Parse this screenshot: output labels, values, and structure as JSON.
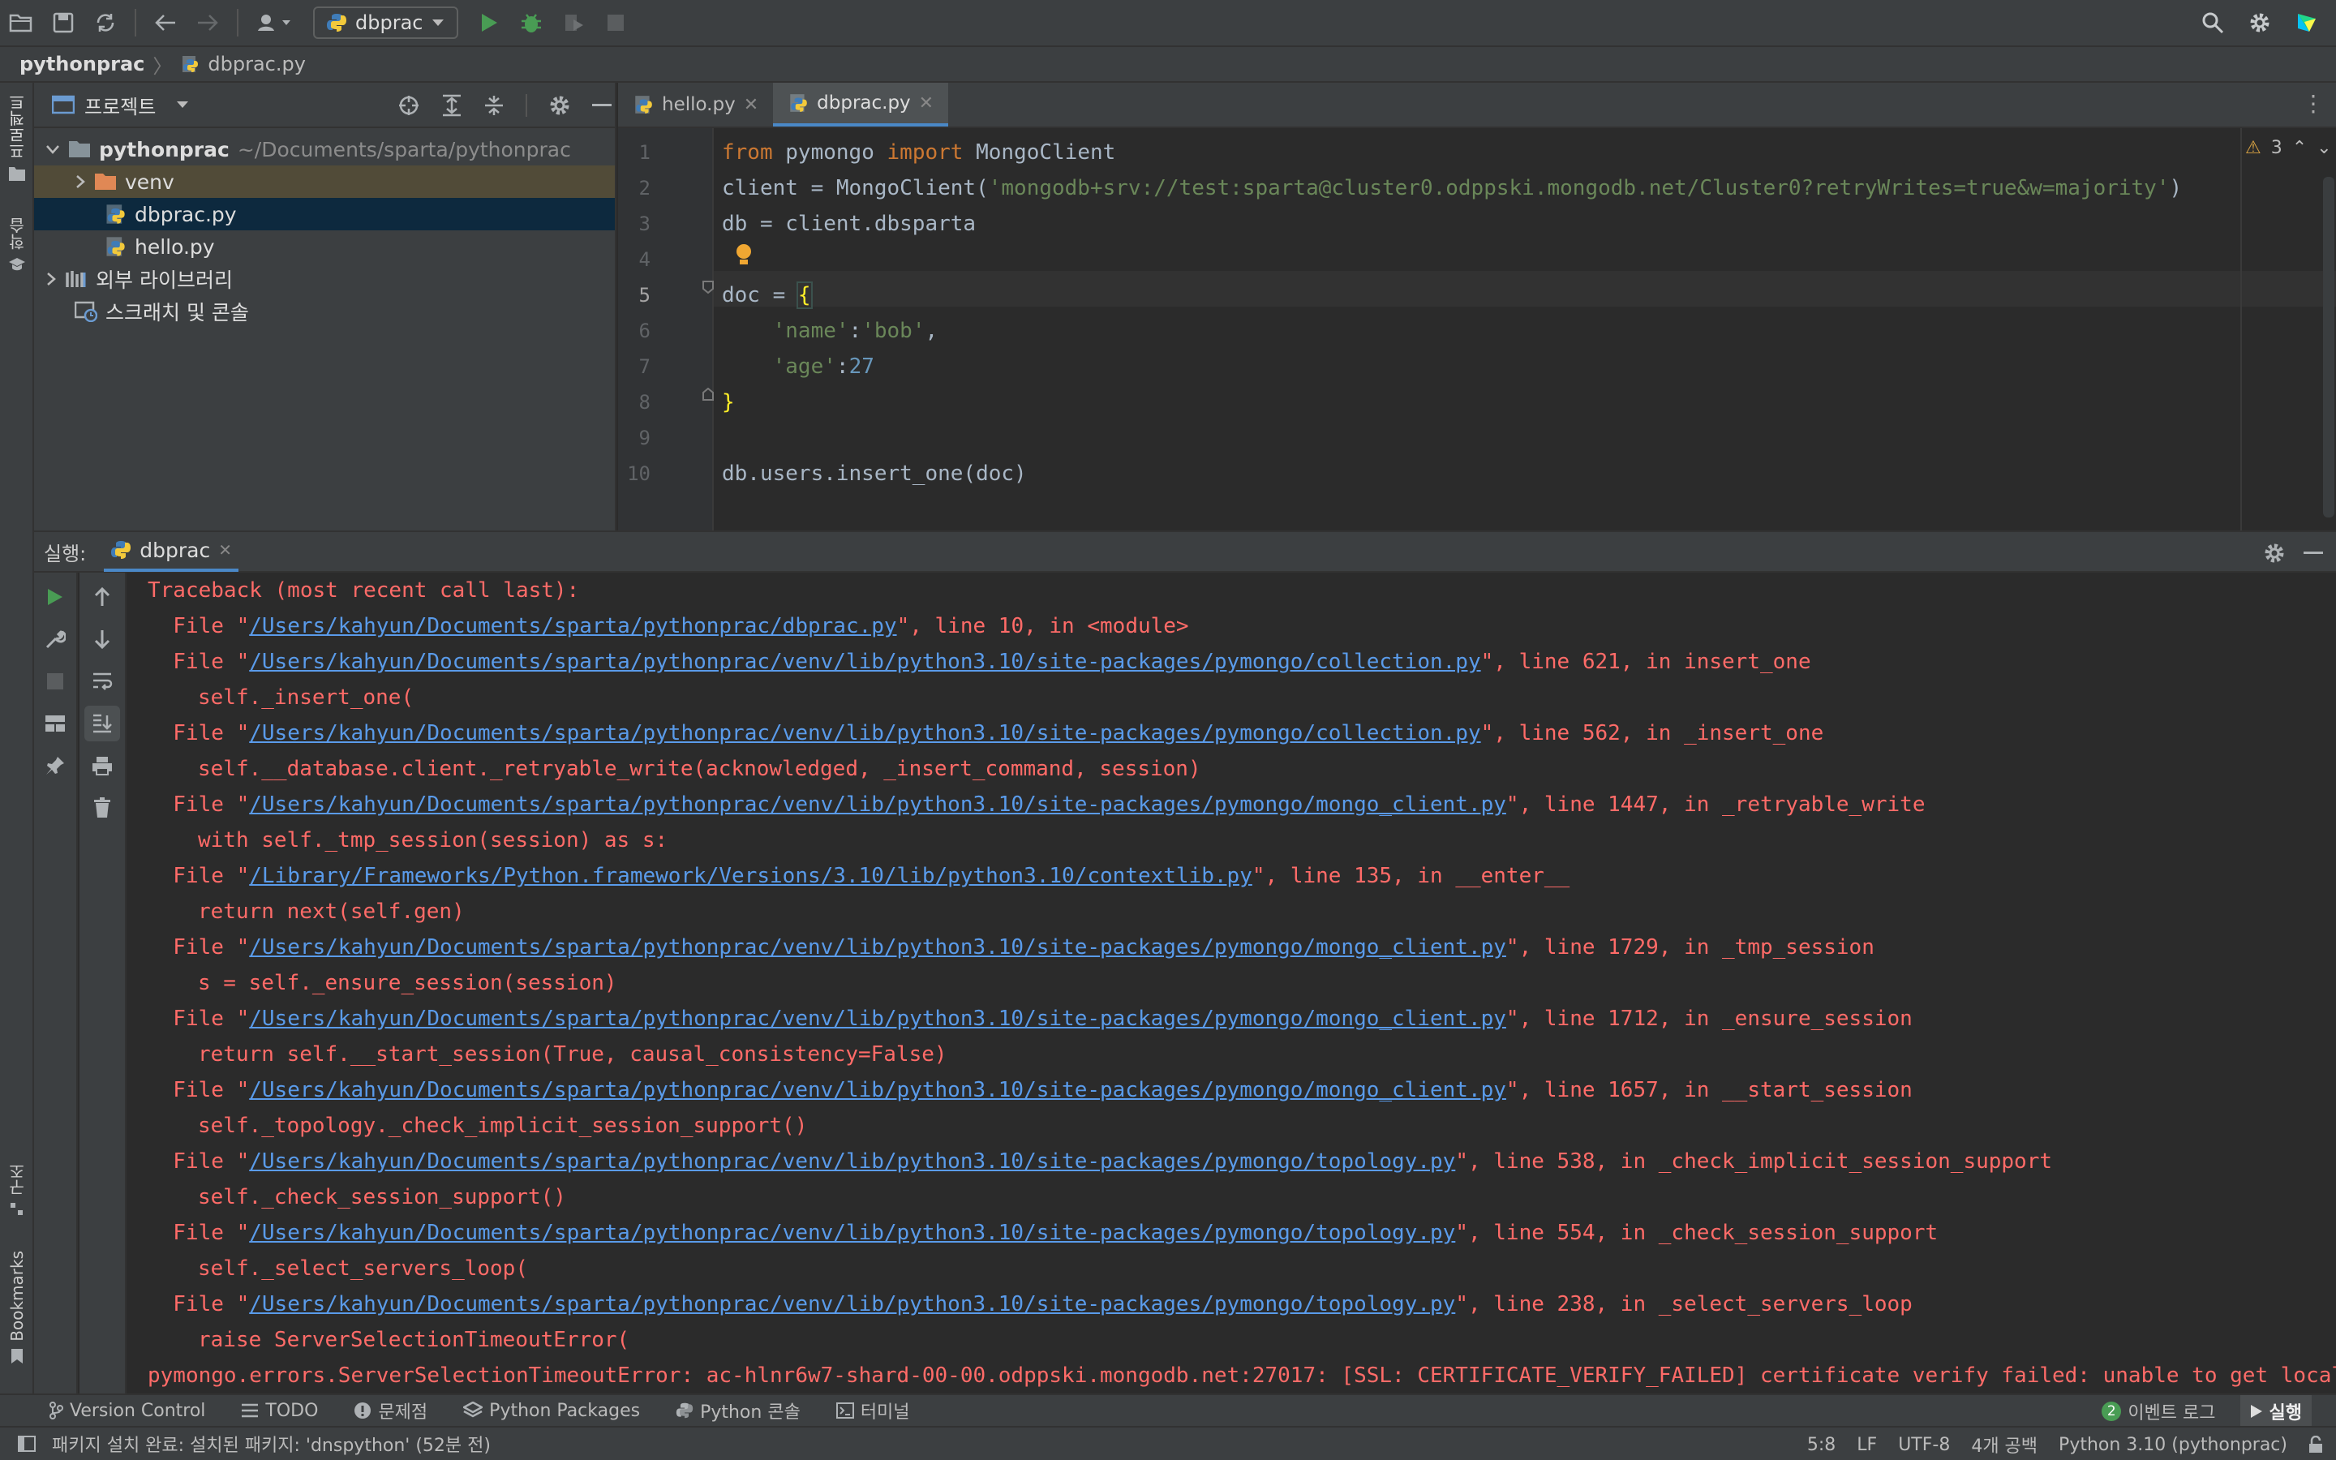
{
  "breadcrumb": {
    "project": "pythonprac",
    "file": "dbprac.py"
  },
  "toolbar": {
    "run_config": "dbprac"
  },
  "project_panel": {
    "title": "프로젝트",
    "root_name": "pythonprac",
    "root_path": "~/Documents/sparta/pythonprac",
    "items": [
      {
        "label": "venv"
      },
      {
        "label": "dbprac.py"
      },
      {
        "label": "hello.py"
      }
    ],
    "external_libs": "외부 라이브러리",
    "scratches": "스크래치 및 콘솔"
  },
  "left_strip": {
    "project_tab": "프로젝트",
    "learn_tab": "학습",
    "structure_tab": "구조",
    "bookmarks_tab": "Bookmarks"
  },
  "editor": {
    "tabs": [
      "hello.py",
      "dbprac.py"
    ],
    "warnings_count": "3",
    "line_numbers": [
      "1",
      "2",
      "3",
      "4",
      "5",
      "6",
      "7",
      "8",
      "9",
      "10"
    ]
  },
  "run_panel": {
    "label": "실행:",
    "tab": "dbprac"
  },
  "console": {
    "traceback_header": "Traceback (most recent call last):",
    "frames": [
      {
        "path": "/Users/kahyun/Documents/sparta/pythonprac/dbprac.py",
        "suffix": "\", line 10, in <module>",
        "code": ""
      },
      {
        "path": "/Users/kahyun/Documents/sparta/pythonprac/venv/lib/python3.10/site-packages/pymongo/collection.py",
        "suffix": "\", line 621, in insert_one",
        "code": "self._insert_one("
      },
      {
        "path": "/Users/kahyun/Documents/sparta/pythonprac/venv/lib/python3.10/site-packages/pymongo/collection.py",
        "suffix": "\", line 562, in _insert_one",
        "code": "self.__database.client._retryable_write(acknowledged, _insert_command, session)"
      },
      {
        "path": "/Users/kahyun/Documents/sparta/pythonprac/venv/lib/python3.10/site-packages/pymongo/mongo_client.py",
        "suffix": "\", line 1447, in _retryable_write",
        "code": "with self._tmp_session(session) as s:"
      },
      {
        "path": "/Library/Frameworks/Python.framework/Versions/3.10/lib/python3.10/contextlib.py",
        "suffix": "\", line 135, in __enter__",
        "code": "return next(self.gen)"
      },
      {
        "path": "/Users/kahyun/Documents/sparta/pythonprac/venv/lib/python3.10/site-packages/pymongo/mongo_client.py",
        "suffix": "\", line 1729, in _tmp_session",
        "code": "s = self._ensure_session(session)"
      },
      {
        "path": "/Users/kahyun/Documents/sparta/pythonprac/venv/lib/python3.10/site-packages/pymongo/mongo_client.py",
        "suffix": "\", line 1712, in _ensure_session",
        "code": "return self.__start_session(True, causal_consistency=False)"
      },
      {
        "path": "/Users/kahyun/Documents/sparta/pythonprac/venv/lib/python3.10/site-packages/pymongo/mongo_client.py",
        "suffix": "\", line 1657, in __start_session",
        "code": "self._topology._check_implicit_session_support()"
      },
      {
        "path": "/Users/kahyun/Documents/sparta/pythonprac/venv/lib/python3.10/site-packages/pymongo/topology.py",
        "suffix": "\", line 538, in _check_implicit_session_support",
        "code": "self._check_session_support()"
      },
      {
        "path": "/Users/kahyun/Documents/sparta/pythonprac/venv/lib/python3.10/site-packages/pymongo/topology.py",
        "suffix": "\", line 554, in _check_session_support",
        "code": "self._select_servers_loop("
      },
      {
        "path": "/Users/kahyun/Documents/sparta/pythonprac/venv/lib/python3.10/site-packages/pymongo/topology.py",
        "suffix": "\", line 238, in _select_servers_loop",
        "code": "raise ServerSelectionTimeoutError("
      }
    ],
    "error_line": "pymongo.errors.ServerSelectionTimeoutError: ac-hlnr6w7-shard-00-00.odppski.mongodb.net:27017: [SSL: CERTIFICATE_VERIFY_FAILED] certificate verify failed: unable to get local"
  },
  "bottom_tools": {
    "version_control": "Version Control",
    "todo": "TODO",
    "problems": "문제점",
    "python_packages": "Python Packages",
    "python_console": "Python 콘솔",
    "terminal": "터미널",
    "event_log_count": "2",
    "event_log": "이벤트 로그",
    "run": "실행"
  },
  "status_bar": {
    "message": "패키지 설치 완료: 설치된 패키지: 'dnspython' (52분 전)",
    "position": "5:8",
    "line_sep": "LF",
    "encoding": "UTF-8",
    "indent": "4개 공백",
    "interpreter": "Python 3.10 (pythonprac)"
  },
  "colors": {
    "accent": "#4a88c7",
    "error": "#ff6b68",
    "link": "#5a9bea",
    "keyword": "#cc7832",
    "string": "#6a8759",
    "number": "#6897bb"
  }
}
